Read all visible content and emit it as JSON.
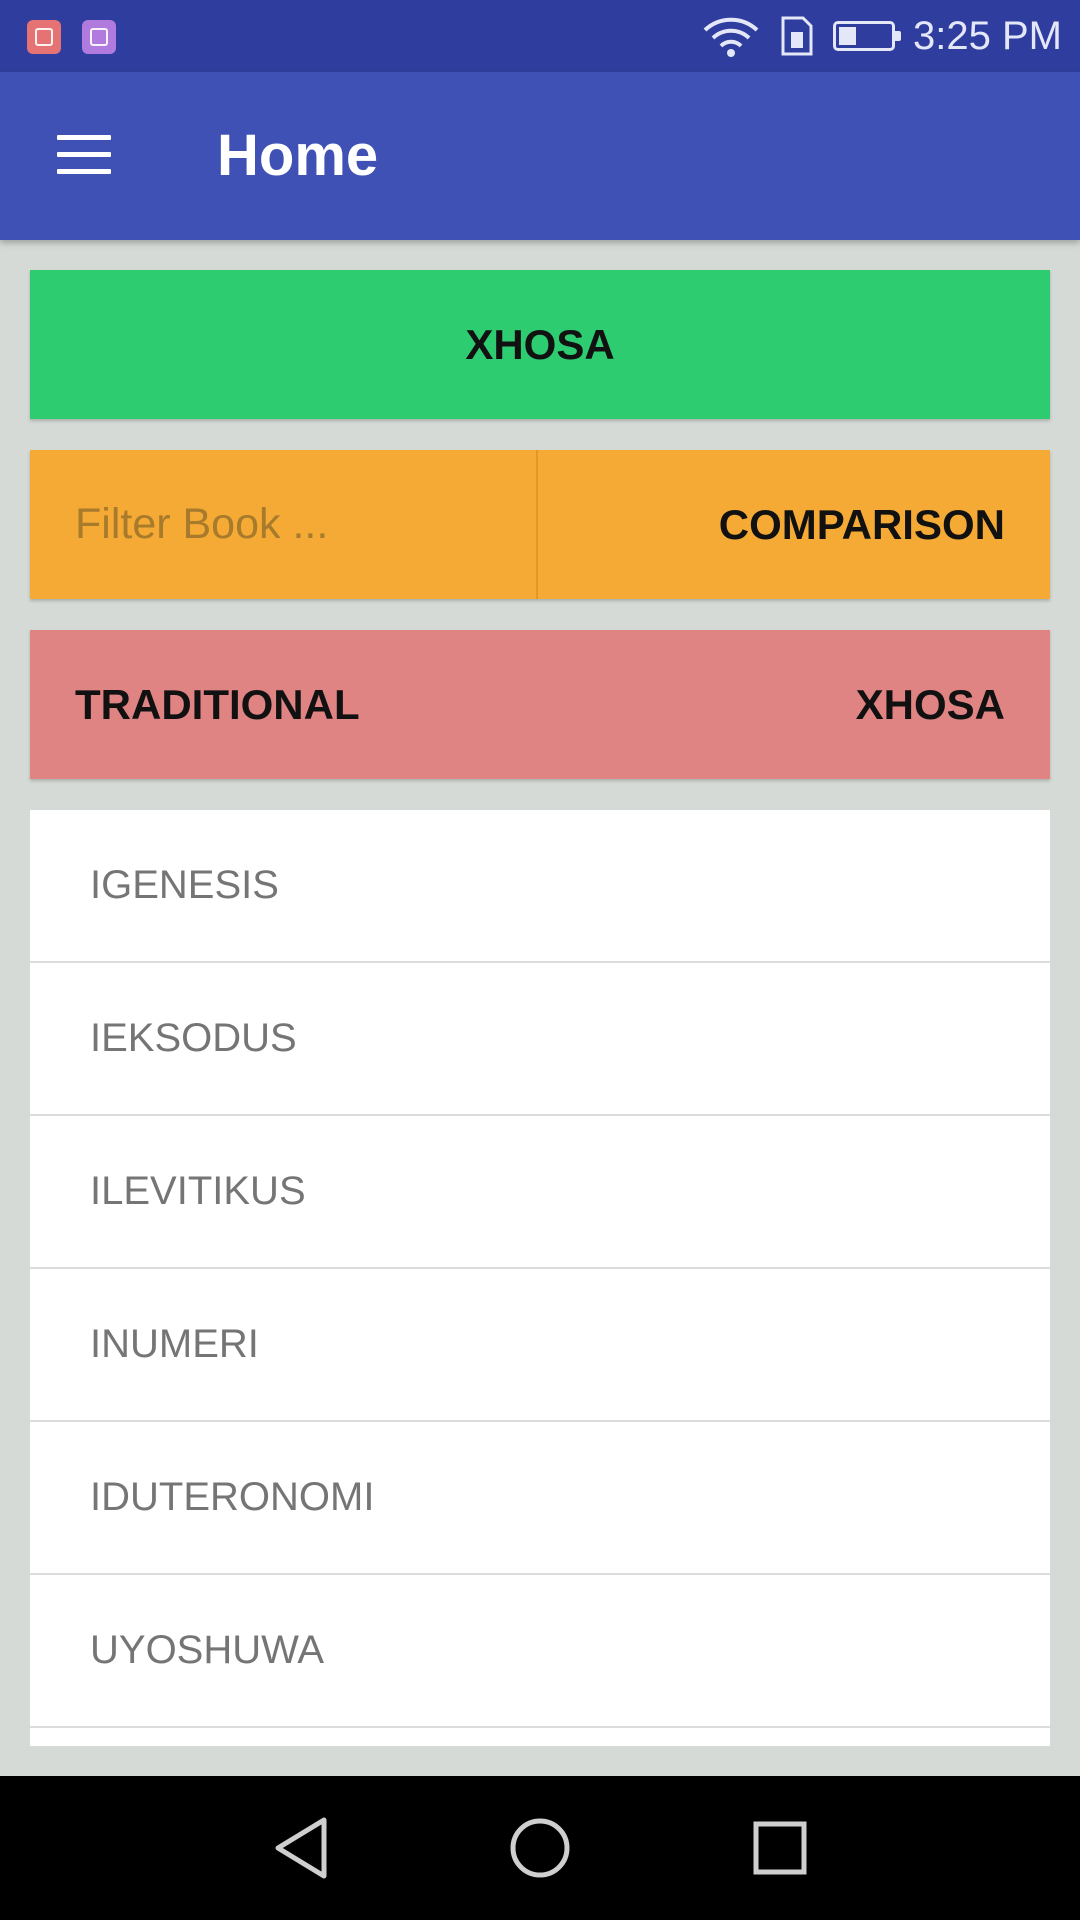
{
  "status_bar": {
    "time": "3:25 PM",
    "icons": [
      "inbox-icon",
      "image-icon",
      "wifi-icon",
      "sim-icon",
      "battery-icon"
    ]
  },
  "app_bar": {
    "title": "Home",
    "menu_icon": "hamburger-menu-icon"
  },
  "language_button": {
    "label": "XHOSA",
    "color": "#2ecc71"
  },
  "filter": {
    "placeholder": "Filter Book ...",
    "value": "",
    "color": "#f5aa35"
  },
  "comparison_button": {
    "label": "COMPARISON"
  },
  "version_toggle": {
    "left_label": "TRADITIONAL",
    "right_label": "XHOSA",
    "color": "#e08383"
  },
  "books": [
    "IGENESIS",
    "IEKSODUS",
    "ILEVITIKUS",
    "INUMERI",
    "IDUTERONOMI",
    "UYOSHUWA"
  ],
  "nav_bar": {
    "icons": [
      "back-icon",
      "home-icon",
      "recents-icon"
    ]
  }
}
